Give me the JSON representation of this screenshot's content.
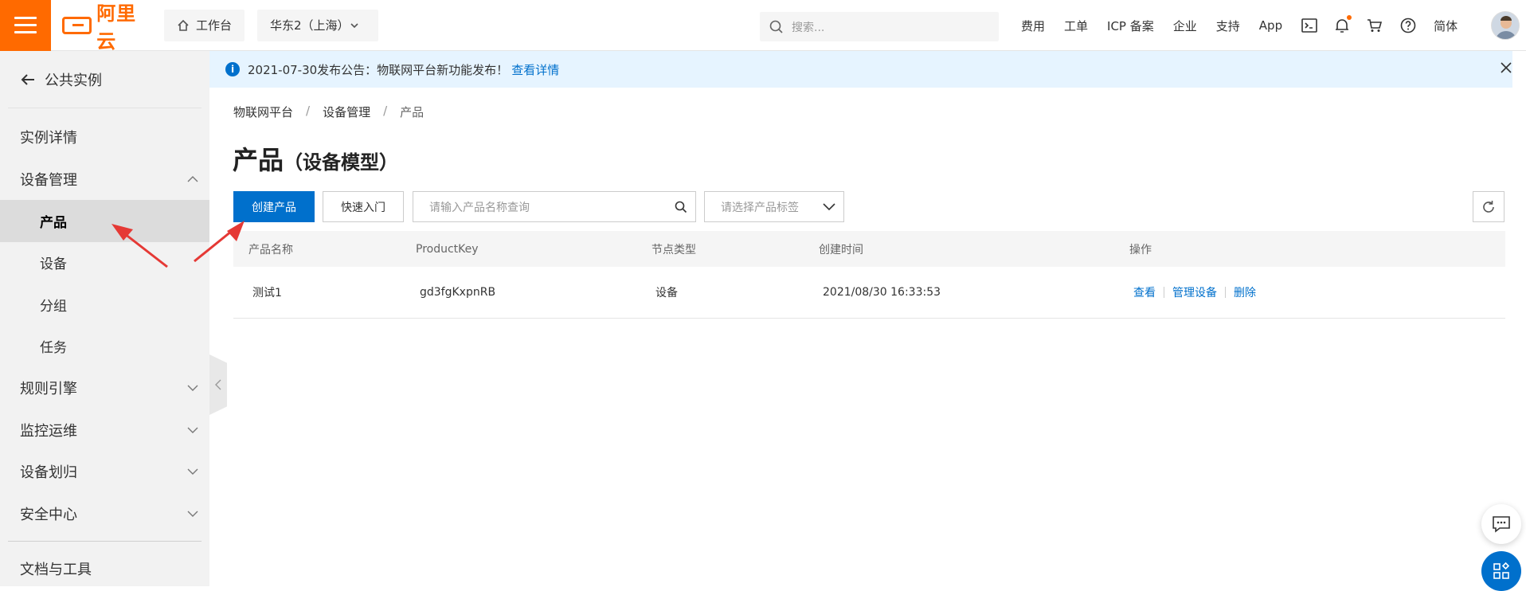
{
  "topbar": {
    "logo_text": "阿里云",
    "workbench": "工作台",
    "region": "华东2（上海）",
    "search_placeholder": "搜索...",
    "nav": [
      "费用",
      "工单",
      "ICP 备案",
      "企业",
      "支持",
      "App"
    ],
    "lang": "简体"
  },
  "sidebar": {
    "back": "公共实例",
    "items": [
      {
        "label": "实例详情"
      },
      {
        "label": "设备管理"
      },
      {
        "label": "产品"
      },
      {
        "label": "设备"
      },
      {
        "label": "分组"
      },
      {
        "label": "任务"
      },
      {
        "label": "规则引擎"
      },
      {
        "label": "监控运维"
      },
      {
        "label": "设备划归"
      },
      {
        "label": "安全中心"
      }
    ],
    "docs": "文档与工具"
  },
  "notice": {
    "text": "2021-07-30发布公告：物联网平台新功能发布！",
    "link": "查看详情"
  },
  "breadcrumb": [
    "物联网平台",
    "设备管理",
    "产品"
  ],
  "page": {
    "title": "产品",
    "subtitle": "（设备模型）"
  },
  "toolbar": {
    "create": "创建产品",
    "quickstart": "快速入门",
    "search_placeholder": "请输入产品名称查询",
    "tag_placeholder": "请选择产品标签"
  },
  "table": {
    "headers": [
      "产品名称",
      "ProductKey",
      "节点类型",
      "创建时间",
      "操作"
    ],
    "rows": [
      {
        "name": "测试1",
        "key": "gd3fgKxpnRB",
        "node_type": "设备",
        "created": "2021/08/30 16:33:53",
        "ops": [
          "查看",
          "管理设备",
          "删除"
        ]
      }
    ]
  },
  "colors": {
    "brand": "#ff6a00",
    "primary": "#0070cc",
    "annotation_arrow": "#e53935"
  }
}
